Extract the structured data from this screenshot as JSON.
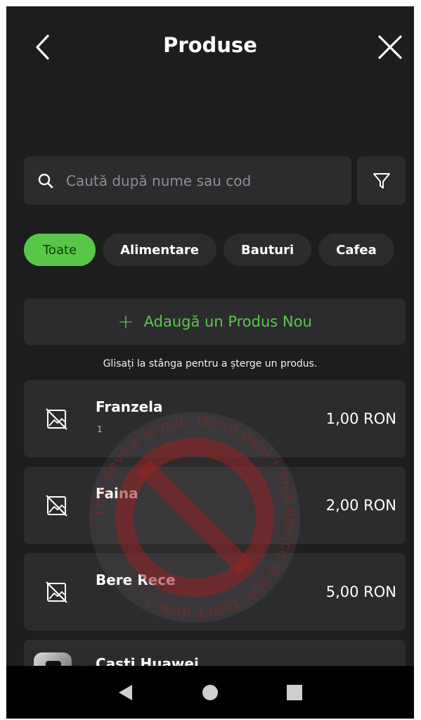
{
  "header": {
    "title": "Produse",
    "back_icon": "chevron-left-icon",
    "close_icon": "close-icon"
  },
  "search": {
    "placeholder": "Caută după nume sau cod",
    "value": "",
    "icon": "search-icon",
    "filter_icon": "filter-icon"
  },
  "categories": [
    {
      "label": "Toate",
      "active": true
    },
    {
      "label": "Alimentare",
      "active": false
    },
    {
      "label": "Bauturi",
      "active": false
    },
    {
      "label": "Cafea",
      "active": false
    }
  ],
  "add_product": {
    "icon": "+",
    "label": "Adaugă un Produs Nou"
  },
  "hint": "Glisați la stânga pentru a șterge un produs.",
  "products": [
    {
      "name": "Franzela",
      "code": "1",
      "price": "1,00 RON",
      "image": "no-image-icon"
    },
    {
      "name": "Faina",
      "code": "",
      "price": "2,00 RON",
      "image": "no-image-icon"
    },
    {
      "name": "Bere Rece",
      "code": "",
      "price": "5,00 RON",
      "image": "no-image-icon"
    },
    {
      "name": "Casti Huawei",
      "code": "",
      "price": "",
      "image": "product-thumbnail"
    }
  ],
  "watermark": {
    "text": "This device is not. Don't deal ! This device is not. Don't deal !",
    "color": "#8a1c1c"
  },
  "navbar": {
    "back": "nav-back-icon",
    "home": "nav-home-icon",
    "recents": "nav-recents-icon"
  },
  "colors": {
    "background": "#1d1d1f",
    "card": "#2c2c2e",
    "accent": "#58c748",
    "accent_text": "#5ac84b"
  }
}
